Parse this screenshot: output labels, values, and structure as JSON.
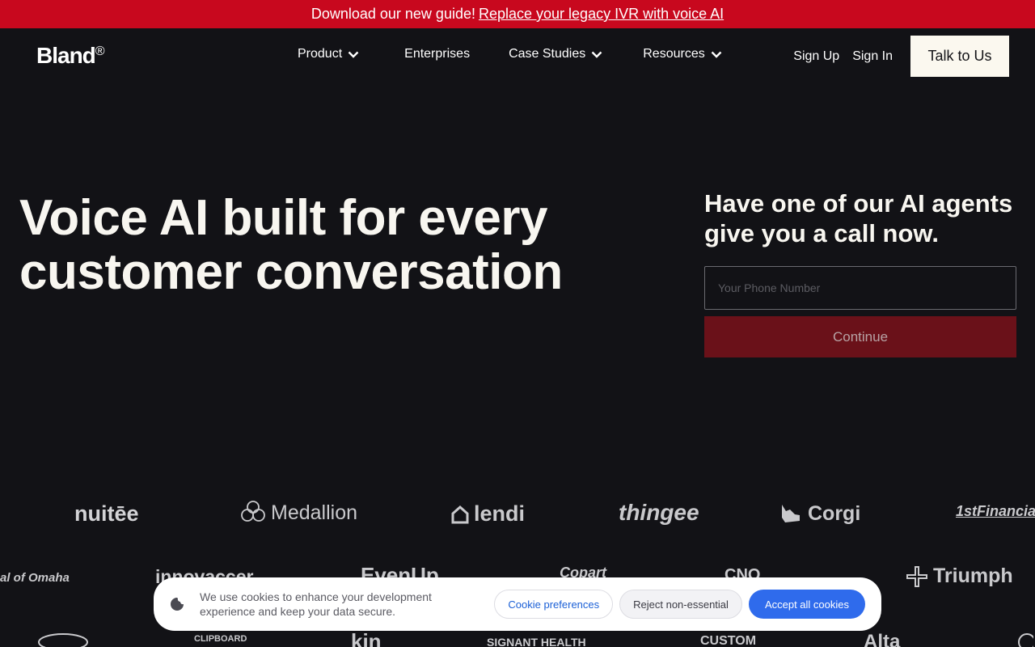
{
  "announcement": {
    "text": "Download our new guide!",
    "link": "Replace your legacy IVR with voice AI"
  },
  "nav": {
    "logo": "Bland",
    "logo_mark": "®",
    "items": [
      {
        "label": "Product",
        "has_dropdown": true
      },
      {
        "label": "Enterprises",
        "has_dropdown": false
      },
      {
        "label": "Case Studies",
        "has_dropdown": true
      },
      {
        "label": "Resources",
        "has_dropdown": true
      }
    ],
    "sign_up": "Sign Up",
    "sign_in": "Sign In",
    "cta": "Talk to Us"
  },
  "hero": {
    "title_line1": "Voice AI built for every",
    "title_line2": "customer conversation"
  },
  "callout": {
    "title_line1": "Have one of our AI agents",
    "title_line2": "give you a call now.",
    "phone_placeholder": "Your Phone Number",
    "button": "Continue"
  },
  "logos": {
    "row1": [
      "nuitēe",
      "Medallion",
      "lendi",
      "thingee",
      "Corgi",
      "1stFinancia"
    ],
    "row2": [
      "al of Omaha",
      "innovaccer",
      "EvenUp",
      "Copart",
      "CNO",
      "Triumph"
    ],
    "row3": [
      "",
      "CLIPBOARD",
      "kin",
      "SIGNANT HEALTH",
      "CUSTOM",
      "Alta",
      ""
    ]
  },
  "cookie": {
    "text": "We use cookies to enhance your development experience and keep your data secure.",
    "preferences": "Cookie preferences",
    "reject": "Reject non-essential",
    "accept": "Accept all cookies"
  },
  "colors": {
    "announcement_bg": "#c8081e",
    "page_bg": "#121216",
    "continue_bg": "#6a1119",
    "accept_bg": "#2f6bec"
  }
}
